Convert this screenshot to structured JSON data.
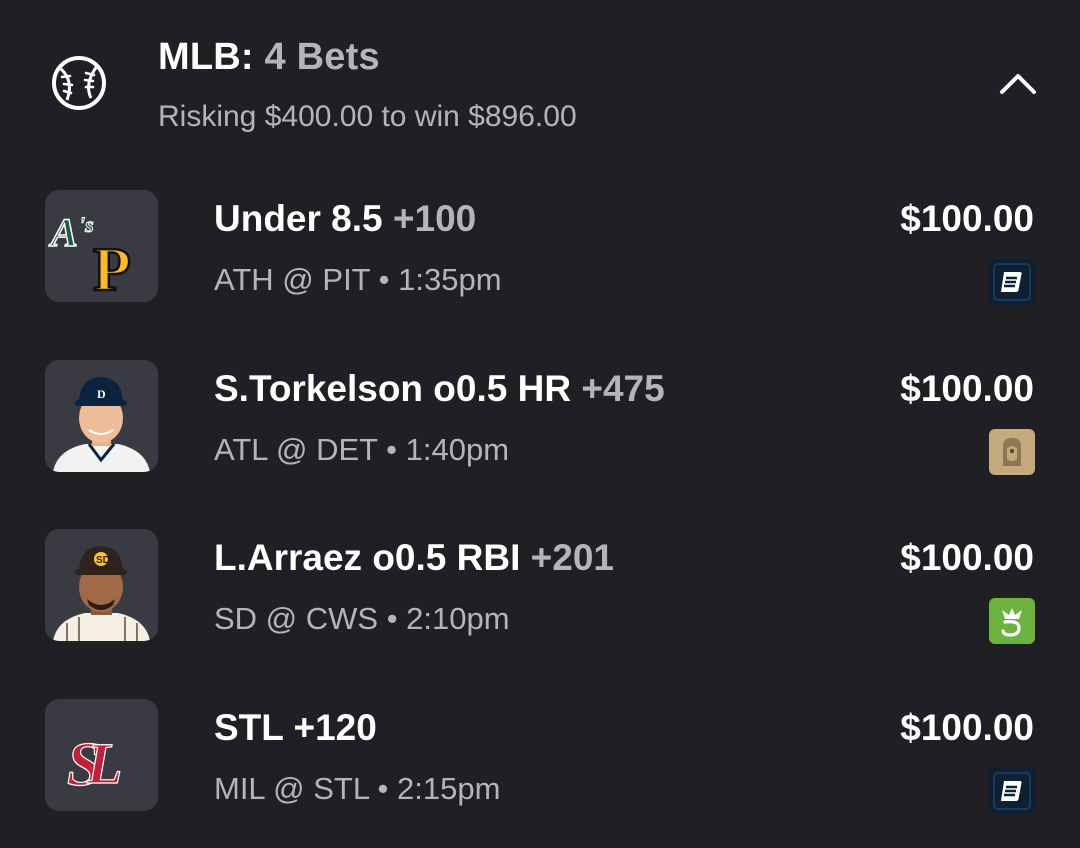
{
  "header": {
    "league": "MLB:",
    "count": "4 Bets",
    "subtitle": "Risking $400.00 to win $896.00",
    "icon": "baseball-icon",
    "collapse_icon": "chevron-up-icon"
  },
  "bets": [
    {
      "selection": "Under 8.5",
      "odds": "+100",
      "matchup": "ATH @ PIT • 1:35pm",
      "amount": "$100.00",
      "thumb": "athletics-pirates-logo",
      "book": "betrivers-icon"
    },
    {
      "selection": "S.Torkelson o0.5 HR",
      "odds": "+475",
      "matchup": "ATL @ DET • 1:40pm",
      "amount": "$100.00",
      "thumb": "player-headshot",
      "book": "betmgm-icon"
    },
    {
      "selection": "L.Arraez o0.5 RBI",
      "odds": "+201",
      "matchup": "SD @ CWS • 2:10pm",
      "amount": "$100.00",
      "thumb": "player-headshot",
      "book": "draftkings-icon"
    },
    {
      "selection": "STL +120",
      "odds": "",
      "matchup": "MIL @ STL • 2:15pm",
      "amount": "$100.00",
      "thumb": "cardinals-logo",
      "book": "betrivers-icon"
    }
  ],
  "colors": {
    "background": "#1f1f24",
    "thumb_bg": "#3a3b42",
    "secondary_text": "#b4b4ba",
    "draftkings_green": "#6cb33f",
    "betmgm_gold": "#c2aa7d",
    "betrivers_navy": "#0e2033",
    "cardinals_red": "#c41e3a",
    "athletics_green": "#1d5a3f",
    "pirates_gold": "#fdb827"
  }
}
